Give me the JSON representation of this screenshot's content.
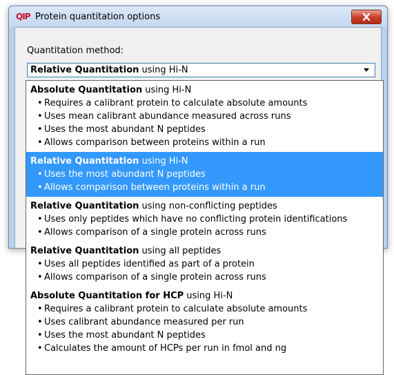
{
  "window": {
    "icon_text": "QIP",
    "title": "Protein quantitation options"
  },
  "form": {
    "method_label": "Quantitation method:",
    "selected_bold": "Relative Quantitation",
    "selected_rest": " using Hi-N"
  },
  "dropdown": {
    "options": [
      {
        "bold": "Absolute Quantitation",
        "rest": " using Hi-N",
        "bullets": [
          "Requires a calibrant protein to calculate absolute amounts",
          "Uses mean calibrant abundance measured across runs",
          "Uses the most abundant N peptides",
          "Allows comparison between proteins within a run"
        ]
      },
      {
        "bold": "Relative Quantitation",
        "rest": " using Hi-N",
        "bullets": [
          "Uses the most abundant N peptides",
          "Allows comparison between proteins within a run"
        ]
      },
      {
        "bold": "Relative Quantitation",
        "rest": " using non-conflicting peptides",
        "bullets": [
          "Uses only peptides which have no conflicting protein identifications",
          "Allows comparison of a single protein across runs"
        ]
      },
      {
        "bold": "Relative Quantitation",
        "rest": " using all peptides",
        "bullets": [
          "Uses all peptides identified as part of a protein",
          "Allows comparison of a single protein across runs"
        ]
      },
      {
        "bold": "Absolute Quantitation for HCP",
        "rest": " using Hi-N",
        "bullets": [
          "Requires a calibrant protein to calculate absolute amounts",
          "Uses calibrant abundance measured per run",
          "Uses the most abundant N peptides",
          "Calculates the amount of HCPs per run in fmol and ng"
        ]
      }
    ]
  },
  "colors": {
    "selection": "#3399ff",
    "close_button": "#c9412a",
    "icon_text": "#c8102e"
  }
}
